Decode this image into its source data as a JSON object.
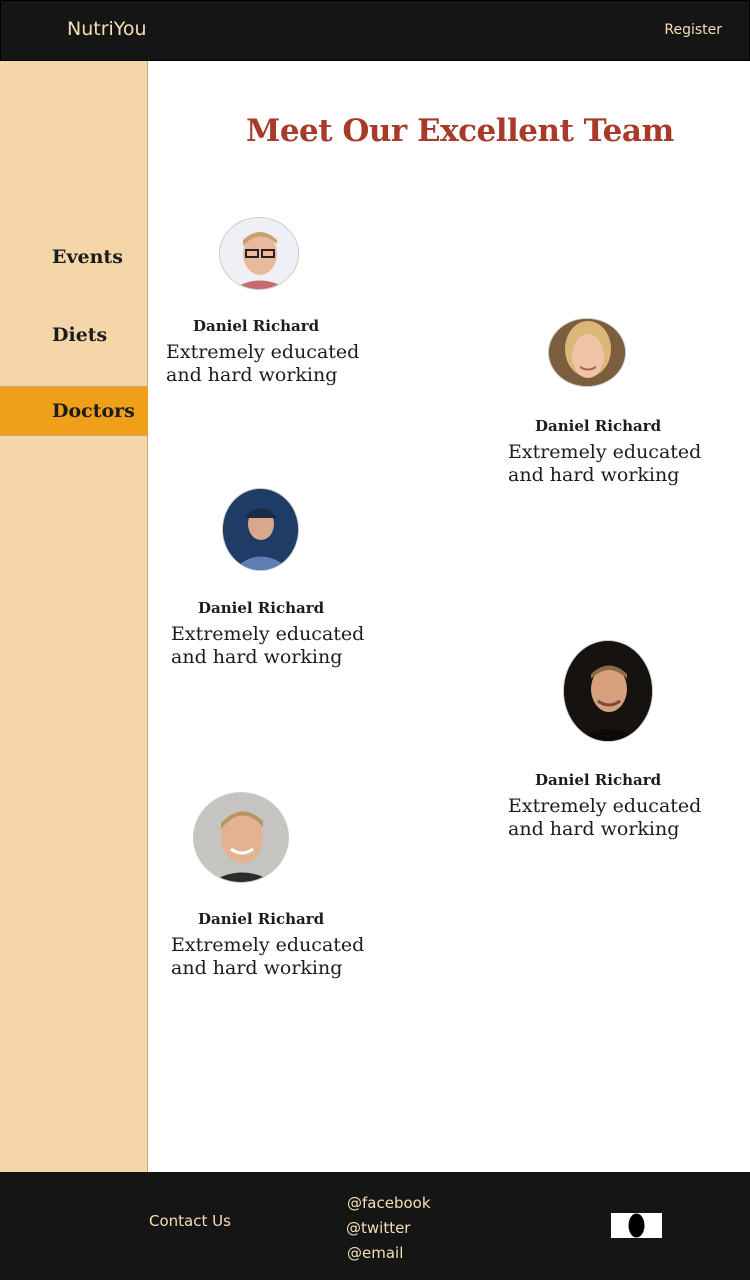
{
  "header": {
    "brand": "NutriYou",
    "register": "Register"
  },
  "sidebar": {
    "items": [
      {
        "label": "Events",
        "active": false
      },
      {
        "label": "Diets",
        "active": false
      },
      {
        "label": "Doctors",
        "active": true
      }
    ]
  },
  "main": {
    "title": "Meet Our Excellent Team",
    "members": [
      {
        "name": "Daniel Richard",
        "description": "Extremely educated and hard working",
        "avatar_icon": "person-glasses-avatar"
      },
      {
        "name": "Daniel Richard",
        "description": "Extremely educated and hard working",
        "avatar_icon": "person-blonde-avatar"
      },
      {
        "name": "Daniel Richard",
        "description": "Extremely educated and hard working",
        "avatar_icon": "person-cap-avatar"
      },
      {
        "name": "Daniel Richard",
        "description": "Extremely educated and hard working",
        "avatar_icon": "person-dark-avatar"
      },
      {
        "name": "Daniel Richard",
        "description": "Extremely educated and hard working",
        "avatar_icon": "person-smile-avatar"
      }
    ]
  },
  "footer": {
    "contact": "Contact Us",
    "links": [
      "@facebook",
      "@twitter",
      "@email"
    ],
    "icon": "eye-logo-icon"
  },
  "colors": {
    "topbar": "#151515",
    "brand_text": "#f3dfb5",
    "sidebar": "#f5d6a8",
    "sidebar_active": "#ef9f18",
    "title": "#a83a2a"
  }
}
